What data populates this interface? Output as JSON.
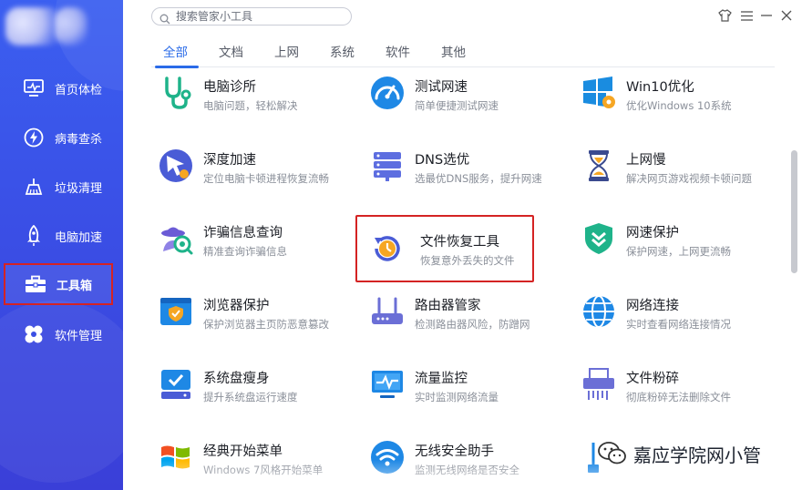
{
  "sidebar": {
    "items": [
      {
        "label": "首页体检",
        "icon": "monitor-icon"
      },
      {
        "label": "病毒查杀",
        "icon": "lightning-shield-icon"
      },
      {
        "label": "垃圾清理",
        "icon": "broom-icon"
      },
      {
        "label": "电脑加速",
        "icon": "rocket-icon"
      },
      {
        "label": "工具箱",
        "icon": "toolbox-icon"
      },
      {
        "label": "软件管理",
        "icon": "apps-icon"
      }
    ],
    "active_index": 4
  },
  "search": {
    "placeholder": "搜索管家小工具"
  },
  "tabs": [
    {
      "label": "全部",
      "active": true
    },
    {
      "label": "文档",
      "active": false
    },
    {
      "label": "上网",
      "active": false
    },
    {
      "label": "系统",
      "active": false
    },
    {
      "label": "软件",
      "active": false
    },
    {
      "label": "其他",
      "active": false
    }
  ],
  "tools": [
    {
      "name": "电脑诊所",
      "desc": "电脑问题，轻松解决",
      "icon": "stethoscope-icon"
    },
    {
      "name": "测试网速",
      "desc": "简单便捷测试网速",
      "icon": "speedometer-icon"
    },
    {
      "name": "Win10优化",
      "desc": "优化Windows 10系统",
      "icon": "windows-gear-icon"
    },
    {
      "name": "深度加速",
      "desc": "定位电脑卡顿进程恢复流畅",
      "icon": "cursor-speed-icon"
    },
    {
      "name": "DNS选优",
      "desc": "选最优DNS服务，提升网速",
      "icon": "server-icon"
    },
    {
      "name": "上网慢",
      "desc": "解决网页游戏视频卡顿问题",
      "icon": "hourglass-icon"
    },
    {
      "name": "诈骗信息查询",
      "desc": "精准查询诈骗信息",
      "icon": "spy-search-icon"
    },
    {
      "name": "文件恢复工具",
      "desc": "恢复意外丢失的文件",
      "icon": "restore-clock-icon"
    },
    {
      "name": "网速保护",
      "desc": "保护网速，上网更流畅",
      "icon": "shield-chevron-icon"
    },
    {
      "name": "浏览器保护",
      "desc": "保护浏览器主页防恶意篡改",
      "icon": "browser-shield-icon"
    },
    {
      "name": "路由器管家",
      "desc": "检测路由器风险，防蹭网",
      "icon": "router-icon"
    },
    {
      "name": "网络连接",
      "desc": "实时查看网络连接情况",
      "icon": "globe-icon"
    },
    {
      "name": "系统盘瘦身",
      "desc": "提升系统盘运行速度",
      "icon": "disk-check-icon"
    },
    {
      "name": "流量监控",
      "desc": "实时监测网络流量",
      "icon": "monitor-pulse-icon"
    },
    {
      "name": "文件粉碎",
      "desc": "彻底粉碎无法删除文件",
      "icon": "shredder-icon"
    },
    {
      "name": "经典开始菜单",
      "desc": "Windows 7风格开始菜单",
      "icon": "windows-flag-icon"
    },
    {
      "name": "无线安全助手",
      "desc": "监测无线网络是否安全",
      "icon": "wifi-icon"
    },
    {
      "name": "",
      "desc": "",
      "icon": "usb-tool-icon"
    }
  ],
  "highlighted_tool": "文件恢复工具",
  "watermark": {
    "text": "嘉应学院网小管"
  },
  "colors": {
    "accent": "#2a6be8",
    "sidebar": "#3a4fe6",
    "highlight": "#d42323"
  }
}
